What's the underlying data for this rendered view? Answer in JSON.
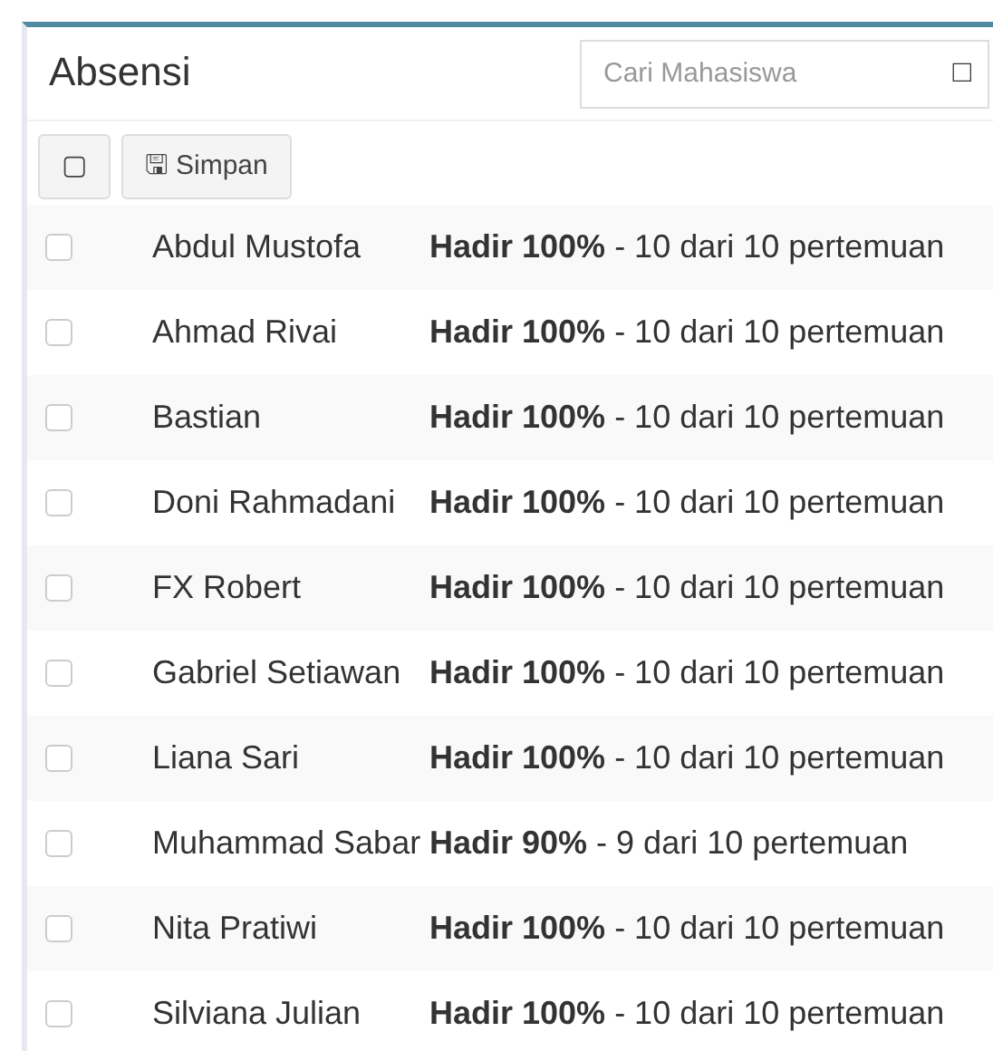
{
  "title": "Absensi",
  "search": {
    "placeholder": "Cari Mahasiswa",
    "icon": "□"
  },
  "toolbar": {
    "select_all": {
      "label": "▢"
    },
    "save": {
      "icon": "🖫",
      "label": "Simpan"
    }
  },
  "rows": [
    {
      "checked": false,
      "name": "Abdul Mustofa",
      "attendance": "**Hadir 100%** - 10 dari 10 pertemuan"
    },
    {
      "checked": false,
      "name": "Ahmad Rivai",
      "attendance": "**Hadir 100%** - 10 dari 10 pertemuan"
    },
    {
      "checked": false,
      "name": "Bastian",
      "attendance": "**Hadir 100%** - 10 dari 10 pertemuan"
    },
    {
      "checked": false,
      "name": "Doni Rahmadani",
      "attendance": "**Hadir 100%** - 10 dari 10 pertemuan"
    },
    {
      "checked": false,
      "name": "FX Robert",
      "attendance": "**Hadir 100%** - 10 dari 10 pertemuan"
    },
    {
      "checked": false,
      "name": "Gabriel Setiawan",
      "attendance": "**Hadir 100%** - 10 dari 10 pertemuan"
    },
    {
      "checked": false,
      "name": "Liana Sari",
      "attendance": "**Hadir 100%** - 10 dari 10 pertemuan"
    },
    {
      "checked": false,
      "name": "Muhammad Sabar",
      "attendance": "**Hadir 90%** - 9 dari 10 pertemuan"
    },
    {
      "checked": false,
      "name": "Nita Pratiwi",
      "attendance": "**Hadir 100%** - 10 dari 10 pertemuan"
    },
    {
      "checked": false,
      "name": "Silviana Julian",
      "attendance": "**Hadir 100%** - 10 dari 10 pertemuan"
    }
  ]
}
